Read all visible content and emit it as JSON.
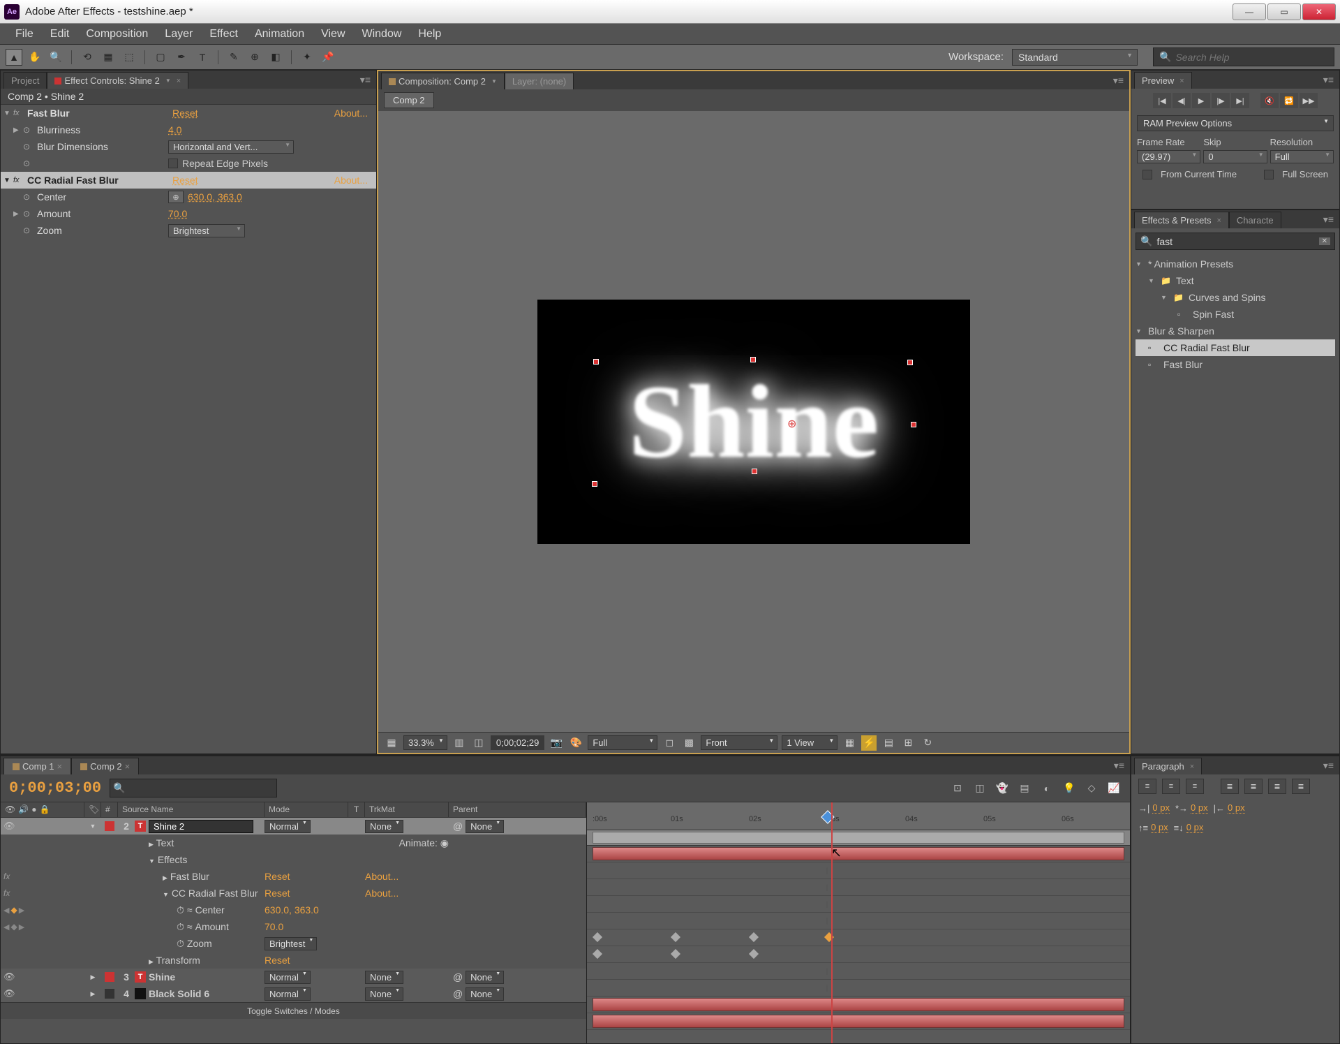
{
  "titlebar": {
    "app": "Adobe After Effects",
    "doc": "testshine.aep *"
  },
  "menu": [
    "File",
    "Edit",
    "Composition",
    "Layer",
    "Effect",
    "Animation",
    "View",
    "Window",
    "Help"
  ],
  "workspace": {
    "label": "Workspace:",
    "value": "Standard"
  },
  "search_help": {
    "placeholder": "Search Help"
  },
  "left_tabs": {
    "project": "Project",
    "ec": "Effect Controls: Shine 2"
  },
  "ec": {
    "breadcrumb": "Comp 2 • Shine 2",
    "fastblur": {
      "name": "Fast Blur",
      "reset": "Reset",
      "about": "About...",
      "blurriness_label": "Blurriness",
      "blurriness": "4.0",
      "blurdim_label": "Blur Dimensions",
      "blurdim": "Horizontal and Vert...",
      "repeat_label": "Repeat Edge Pixels"
    },
    "ccradial": {
      "name": "CC Radial Fast Blur",
      "reset": "Reset",
      "about": "About...",
      "center_label": "Center",
      "center": "630.0, 363.0",
      "amount_label": "Amount",
      "amount": "70.0",
      "zoom_label": "Zoom",
      "zoom": "Brightest"
    }
  },
  "comp": {
    "tab_comp": "Composition: Comp 2",
    "tab_layer": "Layer: (none)",
    "subtab": "Comp 2",
    "text": "Shine"
  },
  "viewer_bar": {
    "zoom": "33.3%",
    "timecode": "0;00;02;29",
    "res": "Full",
    "view3d": "Front",
    "views": "1 View"
  },
  "preview": {
    "title": "Preview",
    "ram": "RAM Preview Options",
    "fr_label": "Frame Rate",
    "skip_label": "Skip",
    "res_label": "Resolution",
    "fr": "(29.97)",
    "skip": "0",
    "res": "Full",
    "from_current": "From Current Time",
    "full_screen": "Full Screen"
  },
  "ep": {
    "tab1": "Effects & Presets",
    "tab2": "Characte",
    "query": "fast",
    "animpresets": "* Animation Presets",
    "text": "Text",
    "curves": "Curves and Spins",
    "spin": "Spin Fast",
    "blur": "Blur & Sharpen",
    "cc": "CC Radial Fast Blur",
    "fb": "Fast Blur"
  },
  "timeline": {
    "tabs": [
      "Comp 1",
      "Comp 2"
    ],
    "time": "0;00;03;00",
    "cols": {
      "num": "#",
      "source": "Source Name",
      "mode": "Mode",
      "t": "T",
      "trkmat": "TrkMat",
      "parent": "Parent"
    },
    "animate": "Animate:",
    "rows": {
      "l2_num": "2",
      "l2_name": "Shine 2",
      "l2_mode": "Normal",
      "l2_trk": "None",
      "l2_parent": "None",
      "text": "Text",
      "effects": "Effects",
      "fastblur": "Fast Blur",
      "fb_reset": "Reset",
      "fb_about": "About...",
      "ccr": "CC Radial Fast Blur",
      "cc_reset": "Reset",
      "cc_about": "About...",
      "center": "Center",
      "center_val": "630.0, 363.0",
      "amount": "Amount",
      "amount_val": "70.0",
      "zoom": "Zoom",
      "zoom_val": "Brightest",
      "transform": "Transform",
      "tr_reset": "Reset",
      "l3_num": "3",
      "l3_name": "Shine",
      "l3_mode": "Normal",
      "l3_trk": "None",
      "l3_parent": "None",
      "l4_num": "4",
      "l4_name": "Black Solid 6",
      "l4_mode": "Normal",
      "l4_trk": "None",
      "l4_parent": "None"
    },
    "ruler": [
      ":00s",
      "01s",
      "02s",
      "03s",
      "04s",
      "05s",
      "06s"
    ],
    "footer": "Toggle Switches / Modes"
  },
  "paragraph": {
    "title": "Paragraph",
    "px": "0 px"
  }
}
